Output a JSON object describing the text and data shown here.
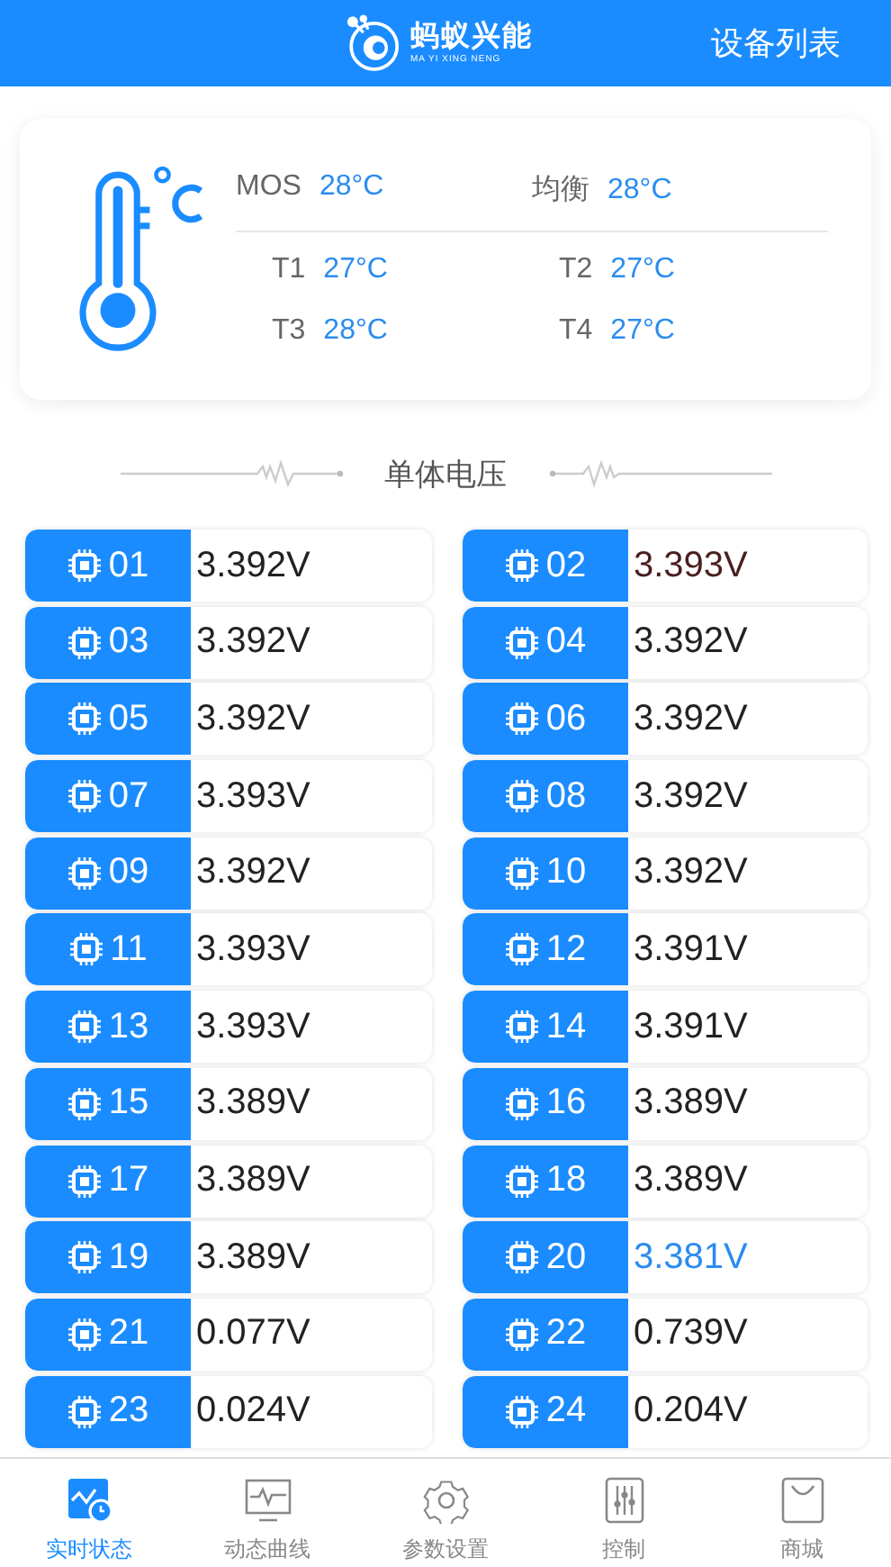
{
  "header": {
    "logo_name": "蚂蚁兴能",
    "logo_subtitle": "MA YI XING NENG",
    "action": "设备列表"
  },
  "temperatures": {
    "top": [
      {
        "label": "MOS",
        "value": "28°C"
      },
      {
        "label": "均衡",
        "value": "28°C"
      }
    ],
    "sensors": [
      {
        "label": "T1",
        "value": "27°C"
      },
      {
        "label": "T2",
        "value": "27°C"
      },
      {
        "label": "T3",
        "value": "28°C"
      },
      {
        "label": "T4",
        "value": "27°C"
      }
    ]
  },
  "section_title": "单体电压",
  "cells": [
    {
      "id": "01",
      "voltage": "3.392V",
      "color": "#222222"
    },
    {
      "id": "02",
      "voltage": "3.393V",
      "color": "#4a1f1f"
    },
    {
      "id": "03",
      "voltage": "3.392V",
      "color": "#222222"
    },
    {
      "id": "04",
      "voltage": "3.392V",
      "color": "#222222"
    },
    {
      "id": "05",
      "voltage": "3.392V",
      "color": "#222222"
    },
    {
      "id": "06",
      "voltage": "3.392V",
      "color": "#222222"
    },
    {
      "id": "07",
      "voltage": "3.393V",
      "color": "#222222"
    },
    {
      "id": "08",
      "voltage": "3.392V",
      "color": "#222222"
    },
    {
      "id": "09",
      "voltage": "3.392V",
      "color": "#222222"
    },
    {
      "id": "10",
      "voltage": "3.392V",
      "color": "#222222"
    },
    {
      "id": "11",
      "voltage": "3.393V",
      "color": "#222222"
    },
    {
      "id": "12",
      "voltage": "3.391V",
      "color": "#222222"
    },
    {
      "id": "13",
      "voltage": "3.393V",
      "color": "#222222"
    },
    {
      "id": "14",
      "voltage": "3.391V",
      "color": "#222222"
    },
    {
      "id": "15",
      "voltage": "3.389V",
      "color": "#222222"
    },
    {
      "id": "16",
      "voltage": "3.389V",
      "color": "#222222"
    },
    {
      "id": "17",
      "voltage": "3.389V",
      "color": "#222222"
    },
    {
      "id": "18",
      "voltage": "3.389V",
      "color": "#222222"
    },
    {
      "id": "19",
      "voltage": "3.389V",
      "color": "#222222"
    },
    {
      "id": "20",
      "voltage": "3.381V",
      "color": "#2a8cf0"
    },
    {
      "id": "21",
      "voltage": "0.077V",
      "color": "#222222"
    },
    {
      "id": "22",
      "voltage": "0.739V",
      "color": "#222222"
    },
    {
      "id": "23",
      "voltage": "0.024V",
      "color": "#222222"
    },
    {
      "id": "24",
      "voltage": "0.204V",
      "color": "#222222"
    }
  ],
  "tabs": [
    {
      "label": "实时状态",
      "kind": "realtime",
      "selected": true
    },
    {
      "label": "动态曲线",
      "kind": "curve",
      "selected": false
    },
    {
      "label": "参数设置",
      "kind": "settings",
      "selected": false
    },
    {
      "label": "控制",
      "kind": "control",
      "selected": false
    },
    {
      "label": "商城",
      "kind": "shop",
      "selected": false
    }
  ]
}
